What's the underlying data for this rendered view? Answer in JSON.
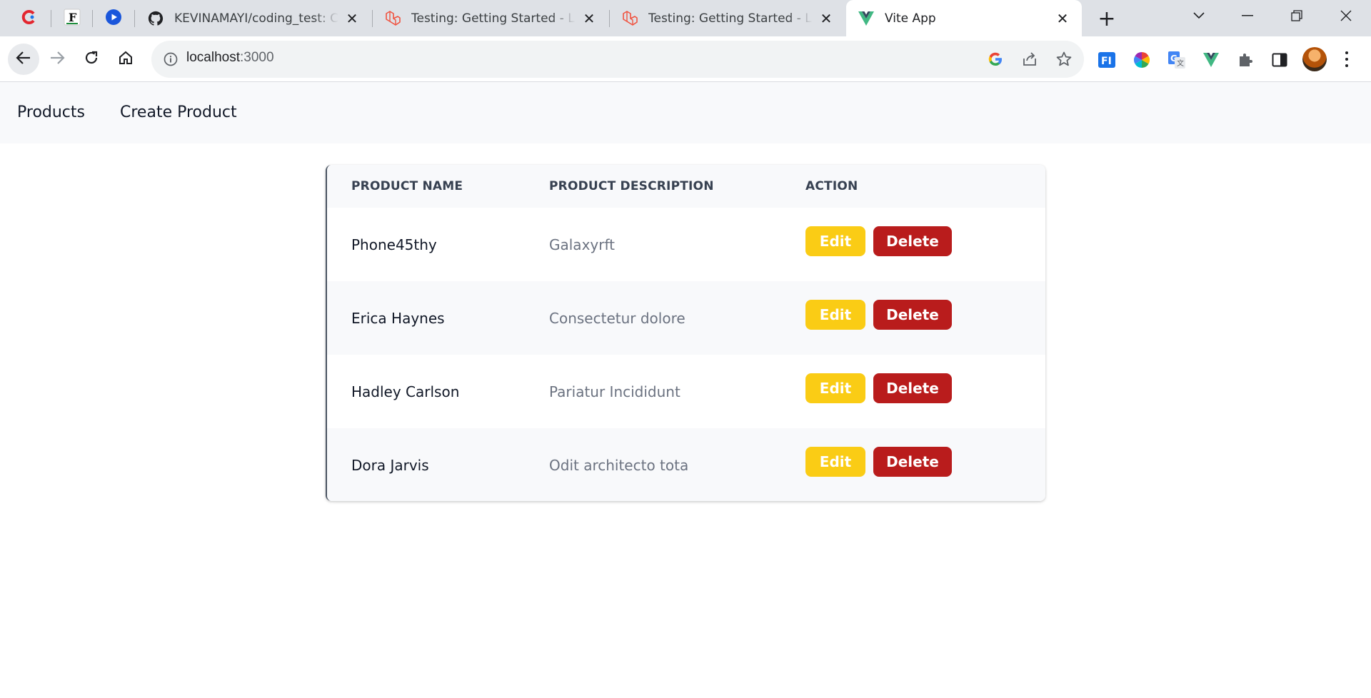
{
  "browser": {
    "tabs": [
      {
        "title": "KEVINAMAYI/coding_test: Co",
        "icon": "github-icon"
      },
      {
        "title": "Testing: Getting Started - Lar",
        "icon": "laravel-icon"
      },
      {
        "title": "Testing: Getting Started - Lar",
        "icon": "laravel-icon"
      },
      {
        "title": "Vite App",
        "icon": "vue-icon",
        "active": true
      }
    ],
    "close_glyph": "✕",
    "new_tab_glyph": "+",
    "url_host": "localhost",
    "url_port": ":3000"
  },
  "nav": {
    "links": [
      "Products",
      "Create Product"
    ]
  },
  "table": {
    "headers": [
      "PRODUCT NAME",
      "PRODUCT DESCRIPTION",
      "ACTION"
    ],
    "rows": [
      {
        "name": "Phone45thy",
        "description": "Galaxyrft"
      },
      {
        "name": "Erica Haynes",
        "description": "Consectetur dolore"
      },
      {
        "name": "Hadley Carlson",
        "description": "Pariatur Incididunt"
      },
      {
        "name": "Dora Jarvis",
        "description": "Odit architecto tota"
      }
    ],
    "edit_label": "Edit",
    "delete_label": "Delete"
  },
  "colors": {
    "edit": "#facc15",
    "delete": "#b91c1c",
    "nav_bg": "#f8f9fb"
  }
}
